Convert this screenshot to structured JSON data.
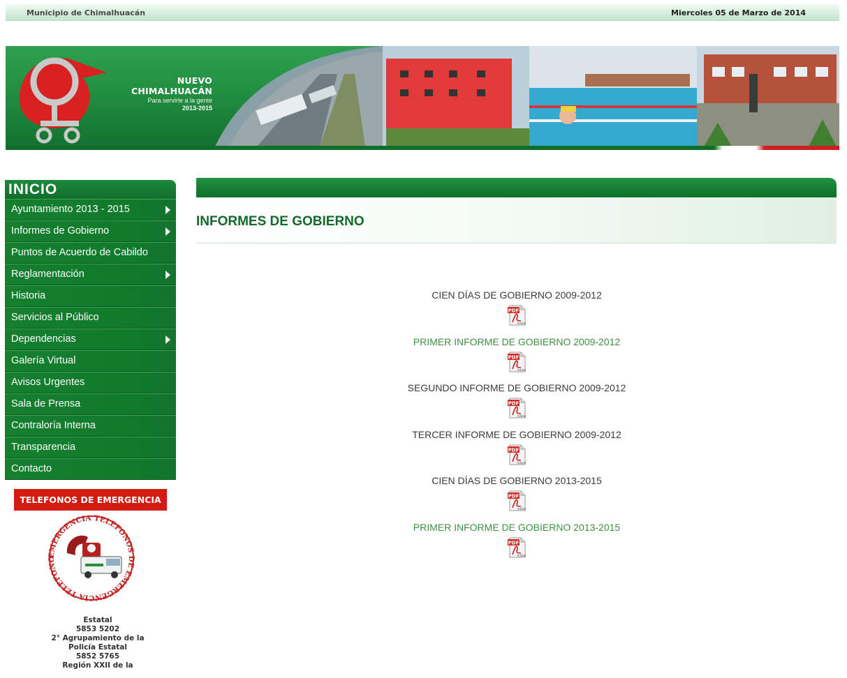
{
  "header": {
    "municipality": "Municipio de Chimalhuacán",
    "date": "Miercoles 05 de Marzo de 2014"
  },
  "banner": {
    "brand_title": "NUEVO CHIMALHUACÁN",
    "slogan": "Para servirle a la gente",
    "period": "2013-2015"
  },
  "nav": {
    "home": "INICIO",
    "items": [
      {
        "label": "Ayuntamiento 2013 - 2015",
        "submenu": true
      },
      {
        "label": "Informes de Gobierno",
        "submenu": true
      },
      {
        "label": "Puntos de Acuerdo de Cabildo",
        "submenu": false
      },
      {
        "label": "Reglamentación",
        "submenu": true
      },
      {
        "label": "Historia",
        "submenu": false
      },
      {
        "label": "Servicios al Público",
        "submenu": false
      },
      {
        "label": "Dependencias",
        "submenu": true
      },
      {
        "label": "Galería Virtual",
        "submenu": false
      },
      {
        "label": "Avisos Urgentes",
        "submenu": false
      },
      {
        "label": "Sala de Prensa",
        "submenu": false
      },
      {
        "label": "Contraloría Interna",
        "submenu": false
      },
      {
        "label": "Transparencia",
        "submenu": false
      },
      {
        "label": "Contacto",
        "submenu": false
      }
    ]
  },
  "emergency": {
    "button": "TELEFONOS DE EMERGENCIA",
    "seal_text": "EMERGENCIA TELEFONOS DE EMERGENCIA TELEFONOS DE",
    "phones": [
      "Estatal",
      "5853 5202",
      "2° Agrupamiento de la",
      "Policía Estatal",
      "5852 5765",
      "Región XXII de la"
    ]
  },
  "content": {
    "title": "INFORMES DE GOBIERNO",
    "reports": [
      {
        "label": "CIEN DÍAS DE GOBIERNO 2009-2012",
        "color": "#3b3b3b"
      },
      {
        "label": "PRIMER INFORME DE GOBIERNO 2009-2012",
        "color": "#3f8f45"
      },
      {
        "label": "SEGUNDO INFORME DE GOBIERNO 2009-2012",
        "color": "#3b3b3b"
      },
      {
        "label": "TERCER INFORME DE GOBIERNO 2009-2012",
        "color": "#3b3b3b"
      },
      {
        "label": "CIEN DÍAS DE GOBIERNO 2013-2015",
        "color": "#3b3b3b"
      },
      {
        "label": "PRIMER INFORME DE GOBIERNO 2013-2015",
        "color": "#3f8f45"
      }
    ],
    "pdf_icon_label": "PDF",
    "pdf_icon_sublabel": "Adobe"
  },
  "colors": {
    "brand_green": "#0f7a2a",
    "emergency_red": "#d31b12"
  }
}
